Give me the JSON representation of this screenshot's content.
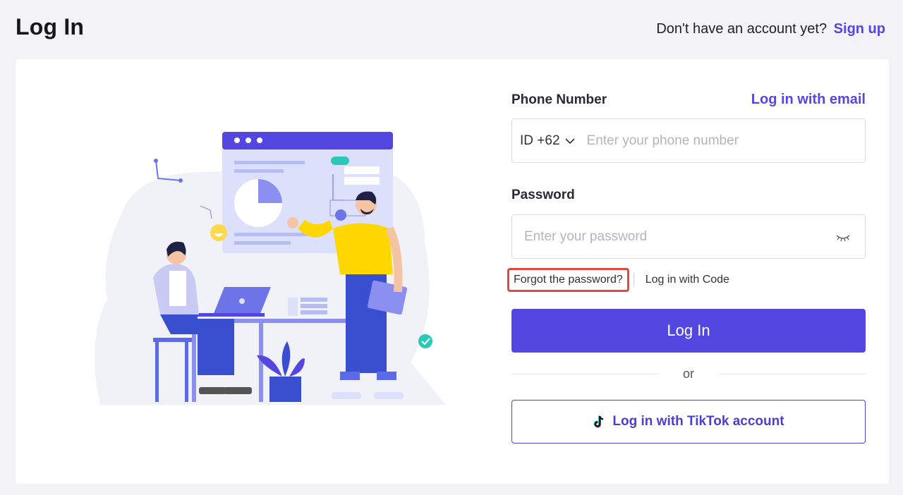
{
  "header": {
    "title": "Log In",
    "signup_prompt": "Don't have an account yet?",
    "signup_link": "Sign up"
  },
  "form": {
    "phone_label": "Phone Number",
    "email_login_link": "Log in with email",
    "country_code": "ID +62",
    "phone_placeholder": "Enter your phone number",
    "password_label": "Password",
    "password_placeholder": "Enter your password",
    "forgot_password": "Forgot the password?",
    "code_login": "Log in with Code",
    "login_button": "Log In",
    "or_text": "or",
    "tiktok_login": "Log in with TikTok account"
  },
  "colors": {
    "accent": "#5446e0",
    "highlight_box": "#e14a3f",
    "background": "#f2f2f7"
  },
  "icons": [
    "chevron-down-icon",
    "eye-closed-icon",
    "tiktok-icon"
  ]
}
